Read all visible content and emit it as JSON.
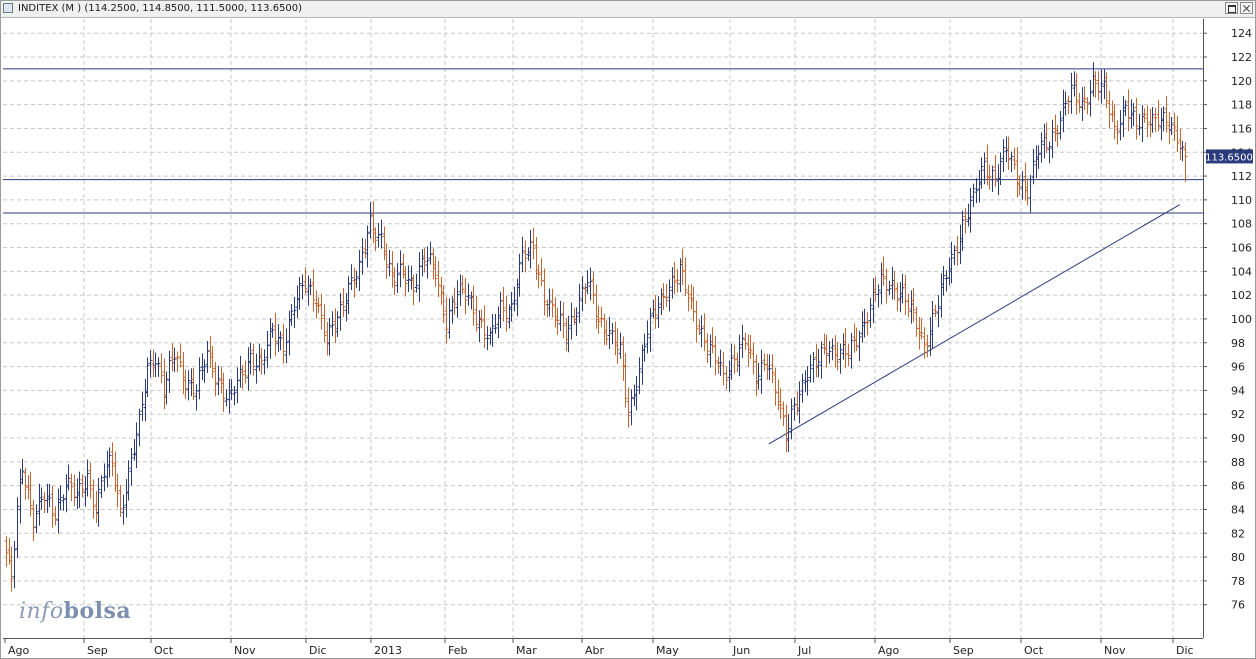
{
  "window": {
    "title": "INDITEX (M ) (114.2500, 114.8500, 111.5000, 113.6500)",
    "restore_icon": "restore-icon",
    "close_icon": "close-icon"
  },
  "watermark": {
    "light": "info",
    "bold": "bolsa"
  },
  "colors": {
    "up_bar": "#2a3a7a",
    "down_bar": "#c8642e",
    "grid": "#c8c8c8",
    "lines": "#2a3a7a",
    "price_label_bg": "#2a3a7a"
  },
  "chart_data": {
    "type": "ohlc",
    "title": "INDITEX (M )",
    "last_ohlc": {
      "open": 114.25,
      "high": 114.85,
      "low": 111.5,
      "close": 113.65
    },
    "last_price_label": "113.6500",
    "ylim": [
      74,
      125
    ],
    "y_ticks": [
      76,
      78,
      80,
      82,
      84,
      86,
      88,
      90,
      92,
      94,
      96,
      98,
      100,
      102,
      104,
      106,
      108,
      110,
      112,
      114,
      116,
      118,
      120,
      122,
      124
    ],
    "x_labels": [
      "Ago",
      "Sep",
      "Oct",
      "Nov",
      "Dic",
      "2013",
      "Feb",
      "Mar",
      "Abr",
      "May",
      "Jun",
      "Jul",
      "Ago",
      "Sep",
      "Oct",
      "Nov",
      "Dic"
    ],
    "grid": true,
    "horizontal_lines": [
      121,
      111.7,
      108.9
    ],
    "trendline": [
      {
        "label": "Jun",
        "day": 17,
        "value": 89.5
      },
      {
        "label": "Dic",
        "day": 5,
        "value": 109.6
      }
    ],
    "keypoints": [
      [
        0,
        80
      ],
      [
        2,
        78
      ],
      [
        4,
        84
      ],
      [
        6,
        88
      ],
      [
        10,
        83
      ],
      [
        14,
        85
      ],
      [
        18,
        84
      ],
      [
        22,
        86
      ],
      [
        26,
        85
      ],
      [
        30,
        87
      ],
      [
        33,
        84
      ],
      [
        36,
        87
      ],
      [
        39,
        88
      ],
      [
        42,
        84
      ],
      [
        46,
        88
      ],
      [
        49,
        91
      ],
      [
        52,
        96
      ],
      [
        55,
        97
      ],
      [
        58,
        94
      ],
      [
        62,
        97
      ],
      [
        66,
        95
      ],
      [
        70,
        94
      ],
      [
        74,
        97
      ],
      [
        78,
        95
      ],
      [
        82,
        93
      ],
      [
        86,
        95
      ],
      [
        90,
        97
      ],
      [
        94,
        96
      ],
      [
        98,
        99
      ],
      [
        102,
        98
      ],
      [
        106,
        101
      ],
      [
        110,
        103
      ],
      [
        114,
        102
      ],
      [
        118,
        98
      ],
      [
        122,
        100
      ],
      [
        126,
        103
      ],
      [
        130,
        104
      ],
      [
        134,
        108
      ],
      [
        138,
        107
      ],
      [
        142,
        103
      ],
      [
        146,
        104
      ],
      [
        150,
        103
      ],
      [
        154,
        105
      ],
      [
        158,
        104
      ],
      [
        162,
        100
      ],
      [
        166,
        102
      ],
      [
        170,
        102
      ],
      [
        174,
        100
      ],
      [
        178,
        98
      ],
      [
        182,
        101
      ],
      [
        186,
        101
      ],
      [
        190,
        105
      ],
      [
        194,
        106
      ],
      [
        198,
        102
      ],
      [
        202,
        100
      ],
      [
        206,
        99
      ],
      [
        210,
        101
      ],
      [
        214,
        103
      ],
      [
        218,
        100
      ],
      [
        222,
        99
      ],
      [
        226,
        97
      ],
      [
        229,
        92
      ],
      [
        232,
        95
      ],
      [
        236,
        99
      ],
      [
        240,
        101
      ],
      [
        244,
        103
      ],
      [
        248,
        104
      ],
      [
        252,
        101
      ],
      [
        256,
        99
      ],
      [
        260,
        97
      ],
      [
        264,
        95
      ],
      [
        268,
        97
      ],
      [
        272,
        98
      ],
      [
        276,
        95
      ],
      [
        280,
        97
      ],
      [
        284,
        93
      ],
      [
        287,
        90
      ],
      [
        290,
        93
      ],
      [
        294,
        95
      ],
      [
        298,
        96
      ],
      [
        302,
        98
      ],
      [
        306,
        97
      ],
      [
        310,
        97
      ],
      [
        314,
        99
      ],
      [
        318,
        101
      ],
      [
        322,
        103
      ],
      [
        326,
        103
      ],
      [
        330,
        102
      ],
      [
        334,
        100
      ],
      [
        338,
        98
      ],
      [
        341,
        100
      ],
      [
        344,
        102
      ],
      [
        348,
        105
      ],
      [
        352,
        108
      ],
      [
        356,
        110
      ],
      [
        360,
        113
      ],
      [
        364,
        112
      ],
      [
        368,
        114
      ],
      [
        372,
        112
      ],
      [
        376,
        111
      ],
      [
        380,
        114
      ],
      [
        384,
        115
      ],
      [
        388,
        117
      ],
      [
        392,
        119
      ],
      [
        396,
        118
      ],
      [
        400,
        120
      ],
      [
        404,
        119
      ],
      [
        408,
        116
      ],
      [
        412,
        118
      ],
      [
        416,
        116
      ],
      [
        420,
        117
      ],
      [
        424,
        117
      ],
      [
        428,
        116
      ],
      [
        432,
        115
      ],
      [
        434,
        113.65
      ]
    ]
  }
}
